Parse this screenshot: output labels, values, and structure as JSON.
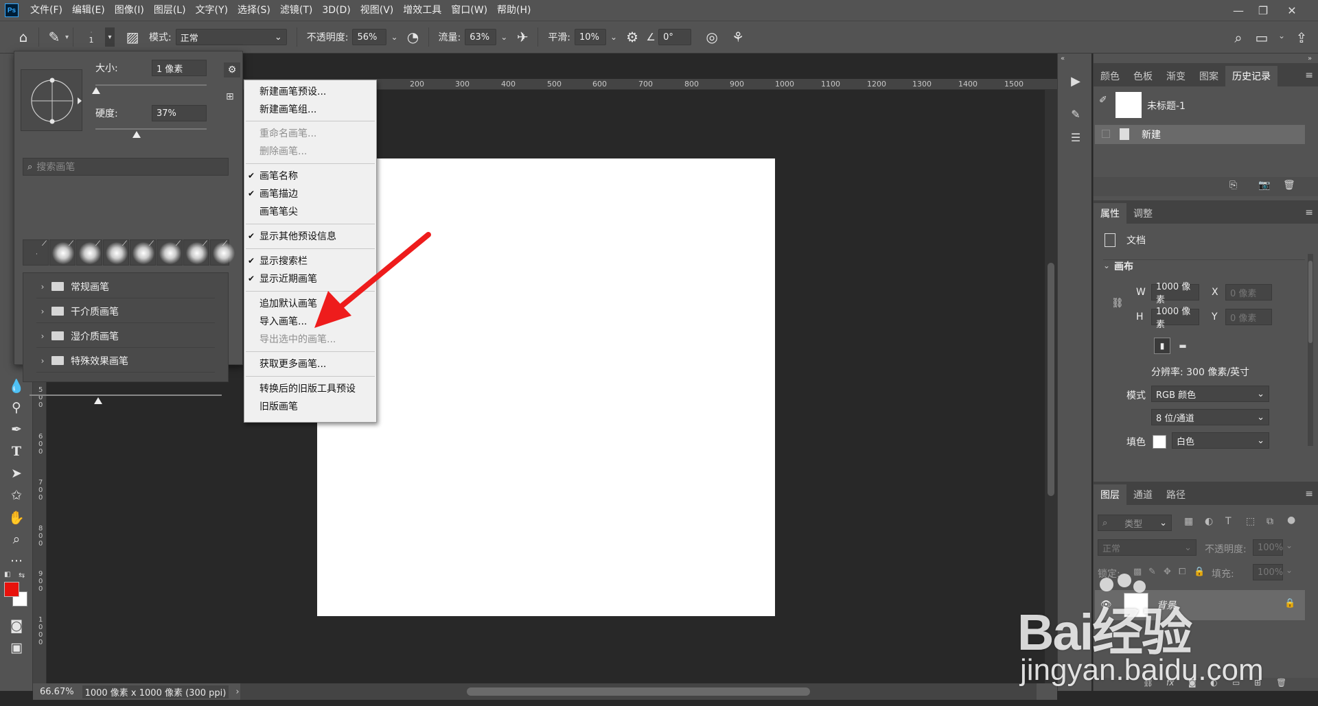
{
  "menubar": {
    "logo": "Ps",
    "items": [
      "文件(F)",
      "编辑(E)",
      "图像(I)",
      "图层(L)",
      "文字(Y)",
      "选择(S)",
      "滤镜(T)",
      "3D(D)",
      "视图(V)",
      "增效工具",
      "窗口(W)",
      "帮助(H)"
    ]
  },
  "options": {
    "brush_size": "1",
    "mode_label": "模式:",
    "mode_value": "正常",
    "opacity_label": "不透明度:",
    "opacity_value": "56%",
    "flow_label": "流量:",
    "flow_value": "63%",
    "smooth_label": "平滑:",
    "smooth_value": "10%",
    "angle_value": "0°"
  },
  "brush_panel": {
    "size_label": "大小:",
    "size_value": "1 像素",
    "hardness_label": "硬度:",
    "hardness_value": "37%",
    "search_placeholder": "搜索画笔",
    "groups": [
      "常规画笔",
      "干介质画笔",
      "湿介质画笔",
      "特殊效果画笔"
    ]
  },
  "context_menu": {
    "items": [
      {
        "label": "新建画笔预设...",
        "enabled": true,
        "checked": false
      },
      {
        "label": "新建画笔组...",
        "enabled": true,
        "checked": false
      },
      {
        "label": "重命名画笔...",
        "enabled": false,
        "checked": false
      },
      {
        "label": "删除画笔...",
        "enabled": false,
        "checked": false
      },
      {
        "label": "画笔名称",
        "enabled": true,
        "checked": true
      },
      {
        "label": "画笔描边",
        "enabled": true,
        "checked": true
      },
      {
        "label": "画笔笔尖",
        "enabled": true,
        "checked": false
      },
      {
        "label": "显示其他预设信息",
        "enabled": true,
        "checked": true
      },
      {
        "label": "显示搜索栏",
        "enabled": true,
        "checked": true
      },
      {
        "label": "显示近期画笔",
        "enabled": true,
        "checked": true
      },
      {
        "label": "追加默认画笔",
        "enabled": true,
        "checked": false
      },
      {
        "label": "导入画笔...",
        "enabled": true,
        "checked": false
      },
      {
        "label": "导出选中的画笔...",
        "enabled": false,
        "checked": false
      },
      {
        "label": "获取更多画笔...",
        "enabled": true,
        "checked": false
      },
      {
        "label": "转换后的旧版工具预设",
        "enabled": true,
        "checked": false
      },
      {
        "label": "旧版画笔",
        "enabled": true,
        "checked": false
      }
    ]
  },
  "ruler": {
    "top_ticks": [
      "200",
      "300",
      "400",
      "500",
      "600",
      "700",
      "800",
      "900",
      "1000",
      "1100",
      "1200",
      "1300",
      "1400",
      "1500"
    ],
    "left_ticks": [
      "5\n0\n0",
      "6\n0\n0",
      "7\n0\n0",
      "8\n0\n0",
      "9\n0\n0",
      "1\n0\n0\n0"
    ]
  },
  "status": {
    "zoom": "66.67%",
    "doc_info": "1000 像素 x 1000 像素 (300 ppi)"
  },
  "history_panel": {
    "tabs": [
      "颜色",
      "色板",
      "渐变",
      "图案",
      "历史记录"
    ],
    "active_tab": "历史记录",
    "snapshot_name": "未标题-1",
    "state_name": "新建"
  },
  "properties_panel": {
    "tabs": [
      "属性",
      "调整"
    ],
    "doc_label": "文档",
    "section": "画布",
    "w_label": "W",
    "w_value": "1000 像素",
    "h_label": "H",
    "h_value": "1000 像素",
    "x_label": "X",
    "x_placeholder": "0 像素",
    "y_label": "Y",
    "y_placeholder": "0 像素",
    "resolution": "分辨率: 300 像素/英寸",
    "mode_label": "模式",
    "mode_value": "RGB 颜色",
    "depth_value": "8 位/通道",
    "fill_label": "填色",
    "fill_value": "白色"
  },
  "layers_panel": {
    "tabs": [
      "图层",
      "通道",
      "路径"
    ],
    "filter_label": "类型",
    "blend_value": "正常",
    "opacity_label": "不透明度:",
    "opacity_value": "100%",
    "lock_label": "锁定:",
    "fill_label": "填充:",
    "fill_value": "100%",
    "layer_name": "背景"
  },
  "watermark": {
    "brand": "Bai经验",
    "url": "jingyan.baidu.com"
  },
  "colors": {
    "foreground": "#e8120c",
    "background": "#ffffff",
    "arrow": "#ee1c1c"
  }
}
